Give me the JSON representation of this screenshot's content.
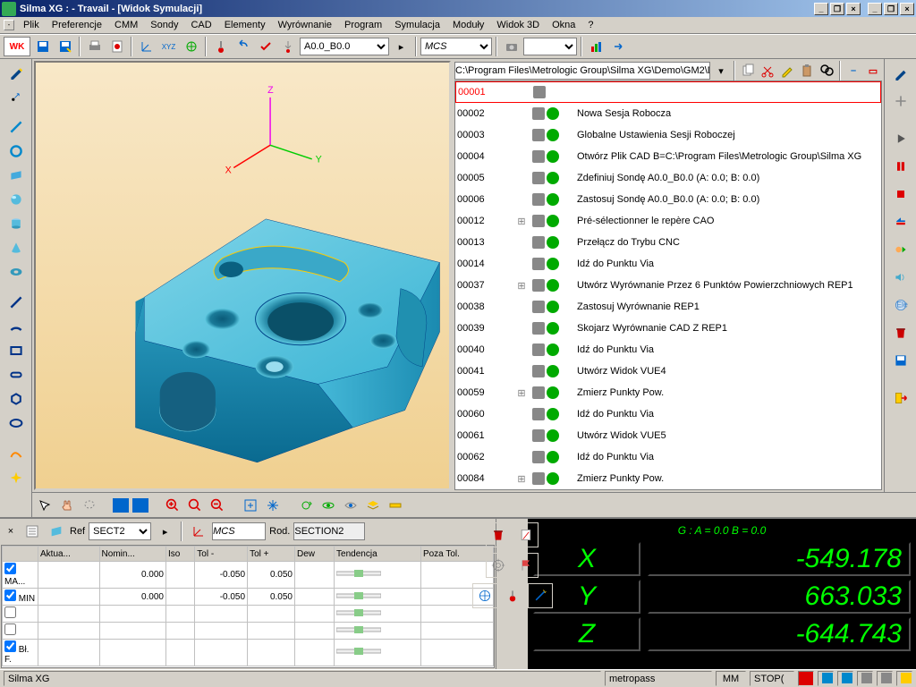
{
  "title": "Silma XG :  - Travail - [Widok Symulacji]",
  "menu": [
    "Plik",
    "Preferencje",
    "CMM",
    "Sondy",
    "CAD",
    "Elementy",
    "Wyrównanie",
    "Program",
    "Symulacja",
    "Moduły",
    "Widok 3D",
    "Okna",
    "?"
  ],
  "probe_combo": "A0.0_B0.0",
  "cs_combo": "MCS",
  "path": "C:\\Program Files\\Metrologic Group\\Silma XG\\Demo\\GM2\\D",
  "program": [
    {
      "n": "00001",
      "t": "",
      "sel": true
    },
    {
      "n": "00002",
      "t": "Nowa Sesja Robocza"
    },
    {
      "n": "00003",
      "t": "Globalne Ustawienia Sesji Roboczej"
    },
    {
      "n": "00004",
      "t": "Otwórz Plik CAD B=C:\\Program Files\\Metrologic Group\\Silma XG"
    },
    {
      "n": "00005",
      "t": "Zdefiniuj Sondę A0.0_B0.0 (A: 0.0; B: 0.0)"
    },
    {
      "n": "00006",
      "t": "Zastosuj Sondę A0.0_B0.0 (A: 0.0; B: 0.0)"
    },
    {
      "n": "00012",
      "t": "Pré-sélectionner le repère CAO",
      "exp": true
    },
    {
      "n": "00013",
      "t": "Przełącz do Trybu CNC"
    },
    {
      "n": "00014",
      "t": "Idź do Punktu Via"
    },
    {
      "n": "00037",
      "t": "Utwórz Wyrównanie Przez 6 Punktów Powierzchniowych REP1",
      "exp": true
    },
    {
      "n": "00038",
      "t": "Zastosuj Wyrównanie REP1"
    },
    {
      "n": "00039",
      "t": "Skojarz Wyrównanie CAD Z REP1"
    },
    {
      "n": "00040",
      "t": "Idź do Punktu Via"
    },
    {
      "n": "00041",
      "t": "Utwórz Widok VUE4"
    },
    {
      "n": "00059",
      "t": "Zmierz Punkty Pow.",
      "exp": true
    },
    {
      "n": "00060",
      "t": "Idź do Punktu Via"
    },
    {
      "n": "00061",
      "t": "Utwórz Widok VUE5"
    },
    {
      "n": "00062",
      "t": "Idź do Punktu Via"
    },
    {
      "n": "00084",
      "t": "Zmierz Punkty Pow.",
      "exp": true
    }
  ],
  "ref_label": "Ref",
  "ref_value": "SECT2",
  "cs2": "MCS",
  "rod_label": "Rod.",
  "rod_value": "SECTION2",
  "table": {
    "headers": [
      "",
      "Aktua...",
      "Nomin...",
      "Iso",
      "Tol -",
      "Tol +",
      "Dew",
      "Tendencja",
      "Poza Tol."
    ],
    "rows": [
      {
        "chk": true,
        "lbl": "MA...",
        "akt": "",
        "nom": "0.000",
        "iso": "",
        "tm": "-0.050",
        "tp": "0.050"
      },
      {
        "chk": true,
        "lbl": "MIN",
        "akt": "",
        "nom": "0.000",
        "iso": "",
        "tm": "-0.050",
        "tp": "0.050"
      },
      {
        "chk": false,
        "lbl": ""
      },
      {
        "chk": false,
        "lbl": ""
      },
      {
        "chk": true,
        "lbl": "Bł. F."
      }
    ]
  },
  "dro": {
    "header": "G : A = 0.0 B = 0.0",
    "x": {
      "l": "X",
      "v": "-549.178"
    },
    "y": {
      "l": "Y",
      "v": "663.033"
    },
    "z": {
      "l": "Z",
      "v": "-644.743"
    }
  },
  "status": {
    "app": "Silma XG",
    "user": "metropass",
    "mm": "MM",
    "stop": "STOP("
  },
  "axis": {
    "x": "X",
    "y": "Y",
    "z": "Z"
  }
}
